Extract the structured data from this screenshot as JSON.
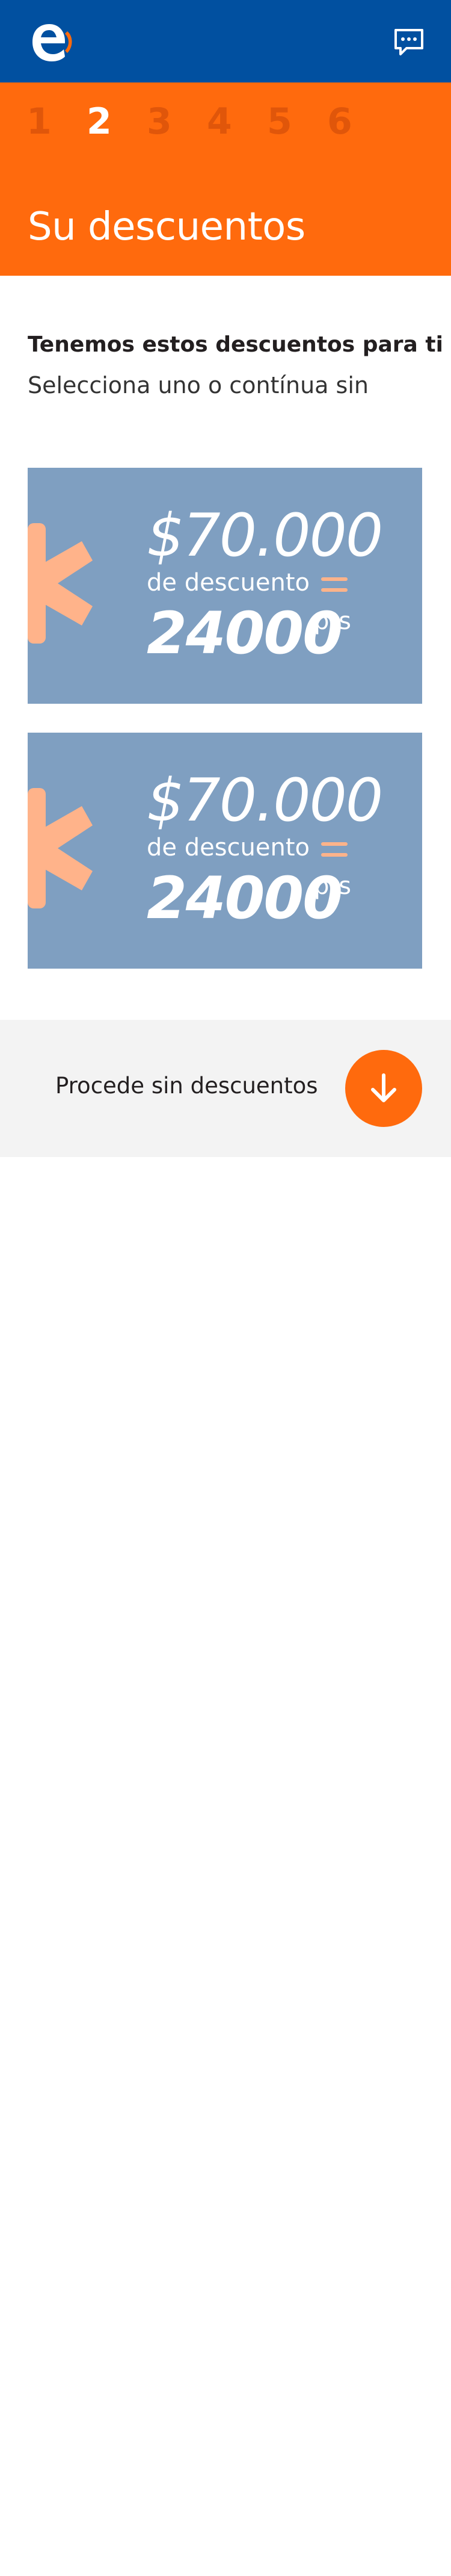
{
  "header": {
    "logo_icon": "entel-logo",
    "chat_icon": "chat-bubble-icon",
    "background": "#0150a0"
  },
  "steps": {
    "items": [
      "1",
      "2",
      "3",
      "4",
      "5",
      "6"
    ],
    "active_index": 1,
    "background": "#ff6a0d"
  },
  "page_title": "Su descuentos",
  "intro": {
    "title": "Tenemos estos descuentos para ti",
    "subtitle": "Selecciona uno o contínua sin"
  },
  "discounts": [
    {
      "amount": "$70.000",
      "desc": "de descuento",
      "points": "24000",
      "points_unit": "pts"
    },
    {
      "amount": "$70.000",
      "desc": "de descuento",
      "points": "24000",
      "points_unit": "pts"
    }
  ],
  "no_discount": {
    "label": "Procede sin descuentos",
    "button_icon": "arrow-down-icon"
  },
  "colors": {
    "card": "#7f9fc1",
    "accent": "#ff6a0d",
    "star": "#ffb38a"
  }
}
